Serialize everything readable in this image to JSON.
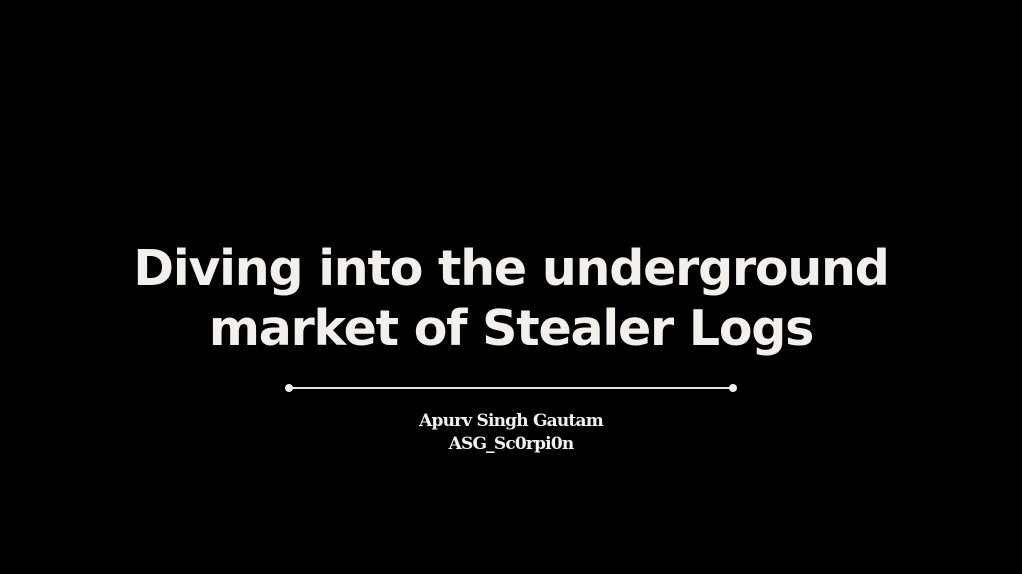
{
  "slide": {
    "title_lines": [
      "Diving into the underground",
      "market of Stealer Logs"
    ],
    "author_name": "Apurv Singh Gautam",
    "author_handle": "ASG_Sc0rpi0n"
  },
  "colors": {
    "background": "#000000",
    "text": "#f2f0ec"
  }
}
